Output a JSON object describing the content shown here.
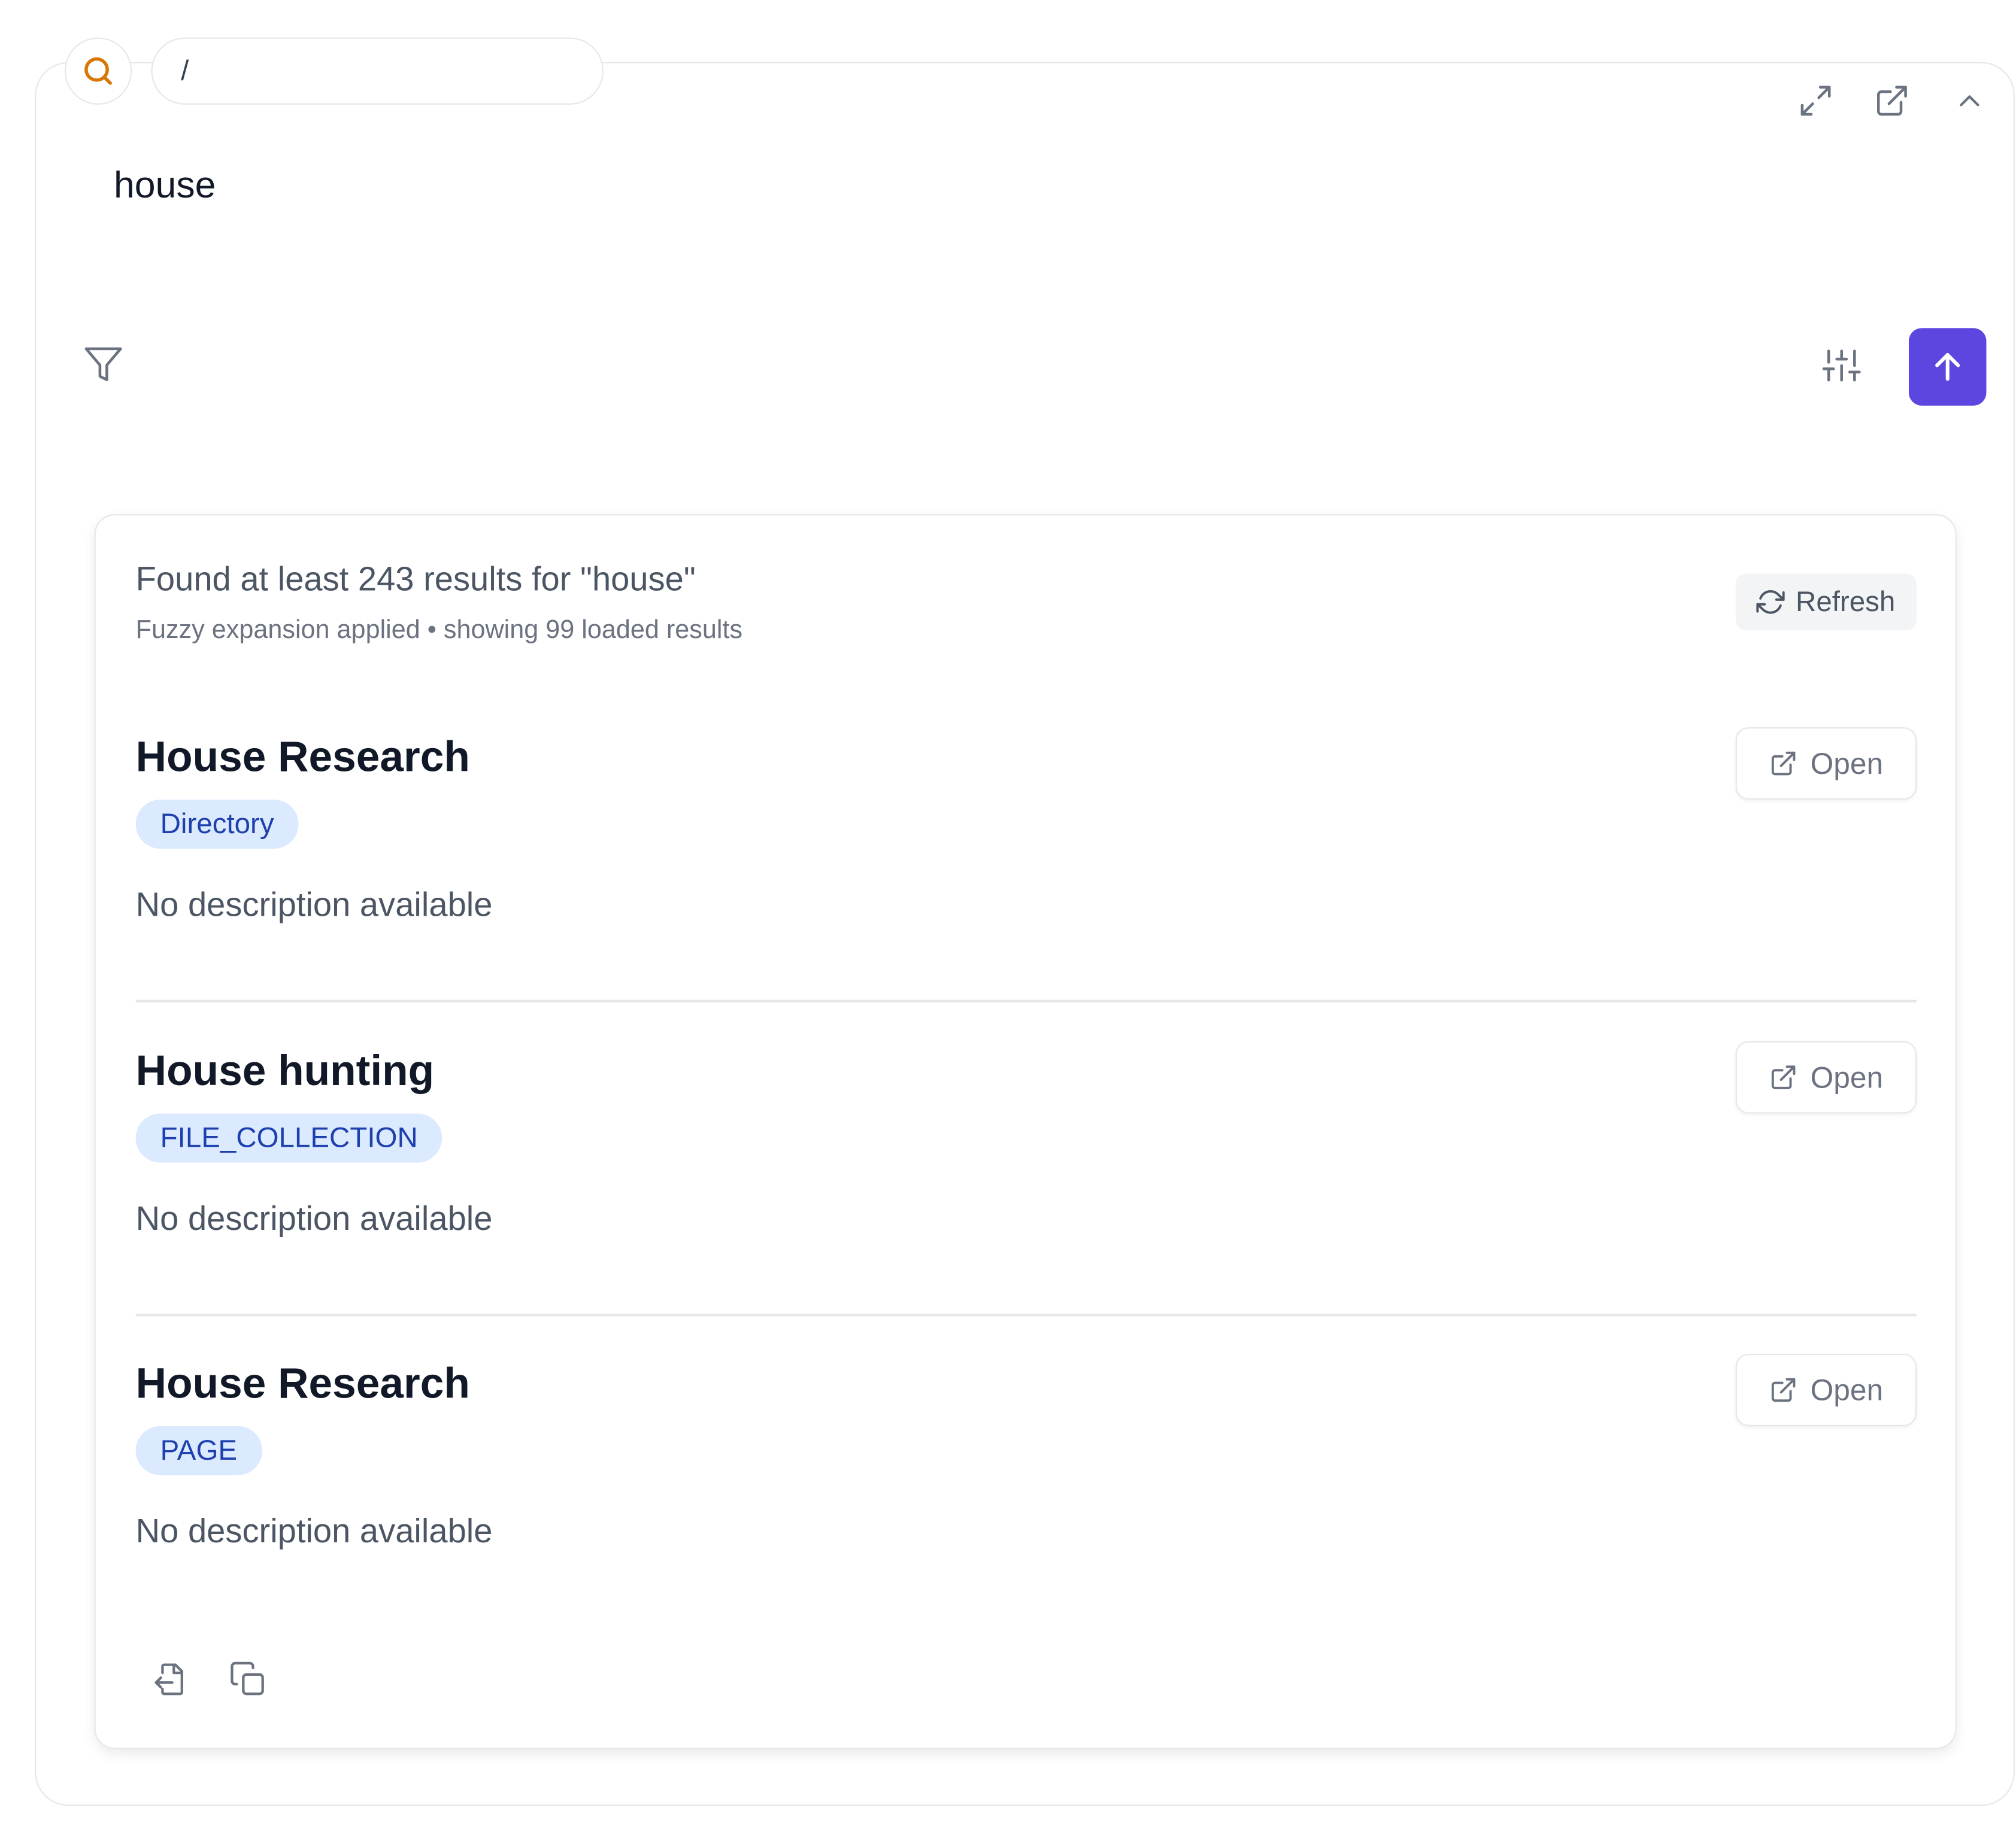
{
  "search": {
    "path_value": "/",
    "query": "house"
  },
  "results": {
    "summary": "Found at least 243 results for \"house\"",
    "subtext": "Fuzzy expansion applied • showing 99 loaded results",
    "refresh_label": "Refresh",
    "open_label": "Open",
    "items": [
      {
        "title": "House Research",
        "badge": "Directory",
        "description": "No description available"
      },
      {
        "title": "House hunting",
        "badge": "FILE_COLLECTION",
        "description": "No description available"
      },
      {
        "title": "House Research",
        "badge": "PAGE",
        "description": "No description available"
      }
    ]
  },
  "colors": {
    "accent": "#5b46e0",
    "search_icon": "#d97706",
    "badge_bg": "#dbeafe",
    "badge_text": "#1e40af"
  },
  "icons": {
    "search": "search-icon",
    "expand": "expand-icon",
    "external": "external-link-icon",
    "collapse": "chevron-up-icon",
    "filter": "filter-icon",
    "settings": "sliders-icon",
    "submit": "arrow-up-icon",
    "refresh": "refresh-icon",
    "export": "export-icon",
    "copy": "copy-icon"
  }
}
